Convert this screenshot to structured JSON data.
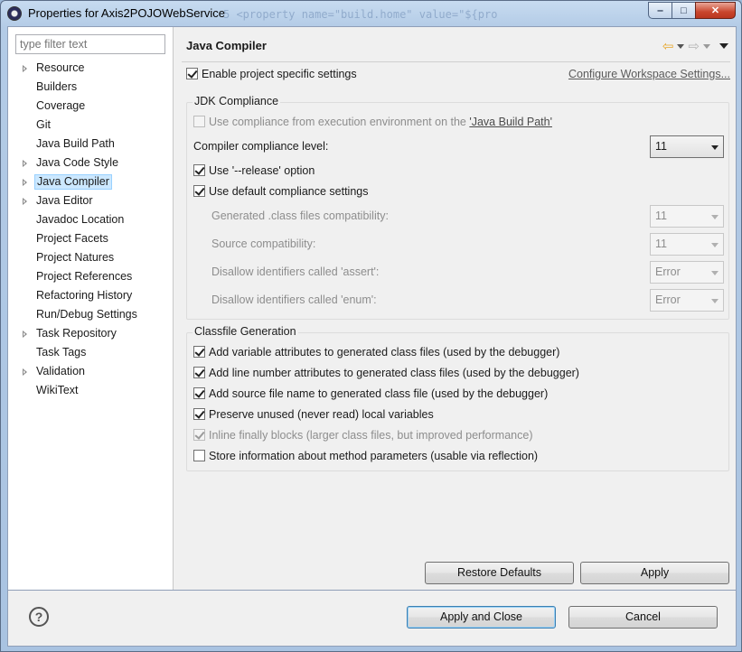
{
  "window": {
    "title": "Properties for Axis2POJOWebService",
    "background_editor_text": "5   <property name=\"build.home\" value=\"${pro",
    "controls": {
      "minimize": "‒",
      "maximize": "□",
      "close": "✕"
    }
  },
  "sidebar": {
    "filter_placeholder": "type filter text",
    "items": [
      {
        "label": "Resource",
        "expandable": true
      },
      {
        "label": "Builders",
        "expandable": false
      },
      {
        "label": "Coverage",
        "expandable": false
      },
      {
        "label": "Git",
        "expandable": false
      },
      {
        "label": "Java Build Path",
        "expandable": false
      },
      {
        "label": "Java Code Style",
        "expandable": true
      },
      {
        "label": "Java Compiler",
        "expandable": true,
        "selected": true
      },
      {
        "label": "Java Editor",
        "expandable": true
      },
      {
        "label": "Javadoc Location",
        "expandable": false
      },
      {
        "label": "Project Facets",
        "expandable": false
      },
      {
        "label": "Project Natures",
        "expandable": false
      },
      {
        "label": "Project References",
        "expandable": false
      },
      {
        "label": "Refactoring History",
        "expandable": false
      },
      {
        "label": "Run/Debug Settings",
        "expandable": false
      },
      {
        "label": "Task Repository",
        "expandable": true
      },
      {
        "label": "Task Tags",
        "expandable": false
      },
      {
        "label": "Validation",
        "expandable": true
      },
      {
        "label": "WikiText",
        "expandable": false
      }
    ]
  },
  "page": {
    "title": "Java Compiler",
    "enable_specific": {
      "label": "Enable project specific settings",
      "checked": true
    },
    "configure_workspace_link": "Configure Workspace Settings...",
    "jdk_compliance": {
      "title": "JDK Compliance",
      "use_env_prefix": "Use compliance from execution environment on the ",
      "use_env_link": "'Java Build Path'",
      "use_env_checked": false,
      "compliance_level_label": "Compiler compliance level:",
      "compliance_level_value": "11",
      "use_release": {
        "label": "Use '--release' option",
        "checked": true
      },
      "use_default": {
        "label": "Use default compliance settings",
        "checked": true
      },
      "generated_label": "Generated .class files compatibility:",
      "generated_value": "11",
      "source_label": "Source compatibility:",
      "source_value": "11",
      "assert_label": "Disallow identifiers called 'assert':",
      "assert_value": "Error",
      "enum_label": "Disallow identifiers called 'enum':",
      "enum_value": "Error"
    },
    "classfile": {
      "title": "Classfile Generation",
      "options": [
        {
          "label": "Add variable attributes to generated class files (used by the debugger)",
          "checked": true,
          "disabled": false
        },
        {
          "label": "Add line number attributes to generated class files (used by the debugger)",
          "checked": true,
          "disabled": false
        },
        {
          "label": "Add source file name to generated class file (used by the debugger)",
          "checked": true,
          "disabled": false
        },
        {
          "label": "Preserve unused (never read) local variables",
          "checked": true,
          "disabled": false
        },
        {
          "label": "Inline finally blocks (larger class files, but improved performance)",
          "checked": true,
          "disabled": true
        },
        {
          "label": "Store information about method parameters (usable via reflection)",
          "checked": false,
          "disabled": false
        }
      ]
    },
    "buttons": {
      "restore_defaults": "Restore Defaults",
      "apply": "Apply"
    }
  },
  "footer": {
    "help_icon": "?",
    "apply_and_close": "Apply and Close",
    "cancel": "Cancel"
  }
}
